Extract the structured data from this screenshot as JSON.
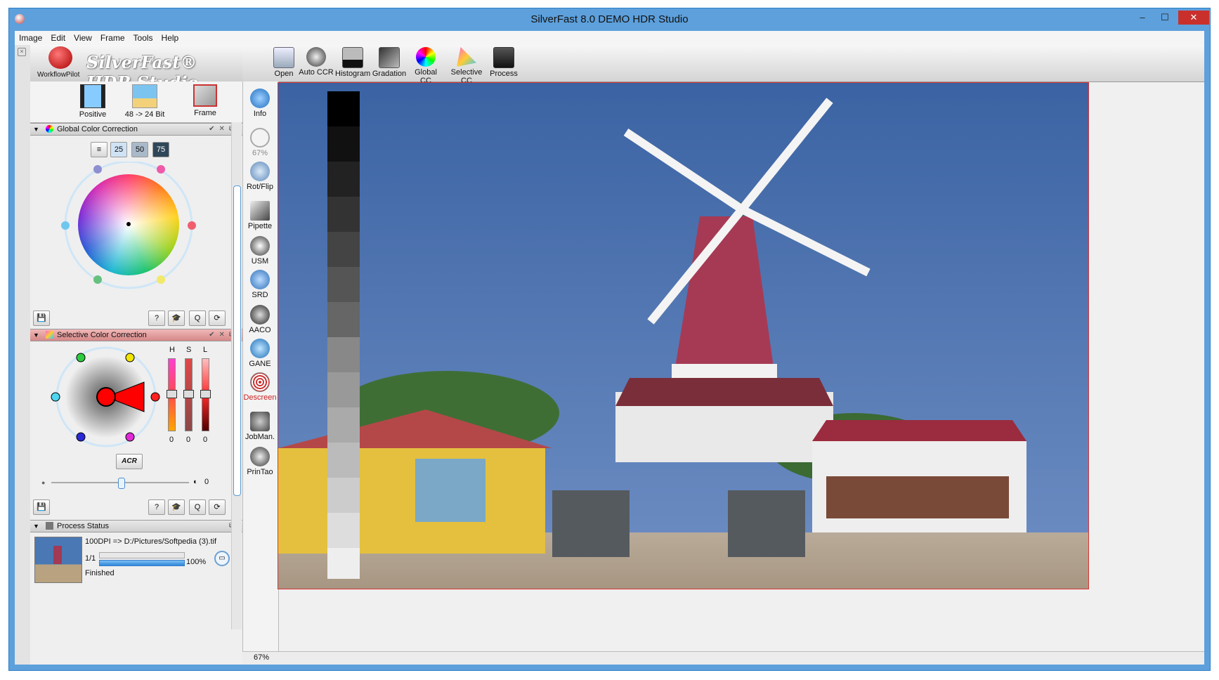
{
  "window": {
    "title": "SilverFast 8.0 DEMO  HDR Studio",
    "min": "–",
    "max": "☐",
    "close": "✕"
  },
  "menu": [
    "Image",
    "Edit",
    "View",
    "Frame",
    "Tools",
    "Help"
  ],
  "logo": {
    "brand": "SilverFast® HDR Studio",
    "workflow_label": "WorkflowPilot"
  },
  "modes": [
    {
      "label": "Positive",
      "icon": "film-strip-icon"
    },
    {
      "label": "48 -> 24 Bit",
      "icon": "palm-beach-icon"
    },
    {
      "label": "Frame",
      "icon": "frame-tools-icon"
    }
  ],
  "gcc": {
    "title": "Global Color Correction",
    "presets": [
      "25",
      "50",
      "75"
    ]
  },
  "scc": {
    "title": "Selective Color Correction",
    "hsl_labels": [
      "H",
      "S",
      "L"
    ],
    "hsl_values": [
      "0",
      "0",
      "0"
    ],
    "acr_label": "ACR",
    "slider_value": "0"
  },
  "process": {
    "title": "Process Status",
    "line1": "100DPI => D:/Pictures/Softpedia (3).tif",
    "count": "1/1",
    "percent": "100%",
    "progress": 1.0,
    "status": "Finished"
  },
  "tools": [
    {
      "label": "Info",
      "icon": "info-icon"
    },
    {
      "label": "67%",
      "icon": "zoom-icon"
    },
    {
      "label": "Rot/Flip",
      "icon": "rotate-flip-icon"
    },
    {
      "label": "Pipette",
      "icon": "pipette-icon"
    },
    {
      "label": "USM",
      "icon": "usm-icon"
    },
    {
      "label": "SRD",
      "icon": "srd-icon"
    },
    {
      "label": "AACO",
      "icon": "aaco-icon"
    },
    {
      "label": "GANE",
      "icon": "gane-icon"
    },
    {
      "label": "Descreen",
      "icon": "descreen-icon"
    },
    {
      "label": "JobMan.",
      "icon": "jobmanager-icon"
    },
    {
      "label": "PrinTao",
      "icon": "printao-icon"
    }
  ],
  "toolbar": [
    {
      "label": "Open",
      "icon": "open-icon"
    },
    {
      "label": "Auto CCR",
      "icon": "auto-ccr-icon"
    },
    {
      "label": "Histogram",
      "icon": "histogram-icon"
    },
    {
      "label": "Gradation",
      "icon": "gradation-icon"
    },
    {
      "label": "Global CC",
      "icon": "global-cc-icon"
    },
    {
      "label": "Selective CC",
      "icon": "selective-cc-icon"
    },
    {
      "label": "Process",
      "icon": "process-icon"
    }
  ],
  "status": {
    "zoom": "67%"
  },
  "colors": {
    "accent": "#5da0dc",
    "close": "#c9302c",
    "sky": "#3e6aa6",
    "roof": "#a63a55"
  }
}
